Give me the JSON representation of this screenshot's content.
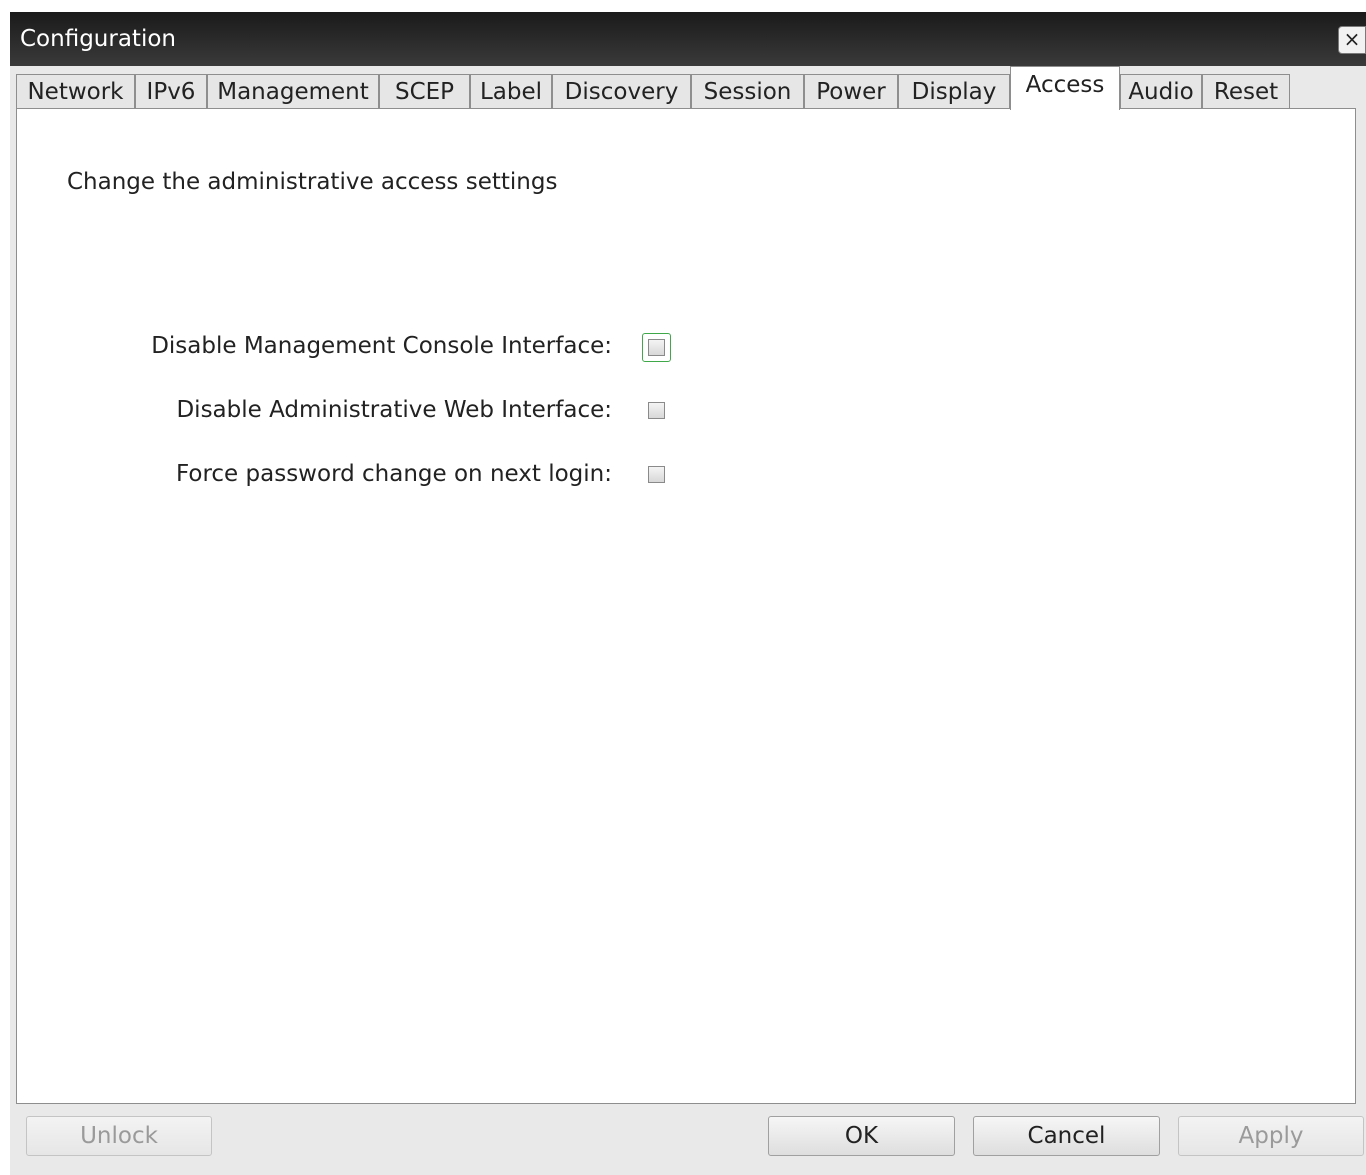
{
  "window": {
    "title": "Configuration",
    "close_label": "×"
  },
  "tabs": [
    {
      "label": "Network"
    },
    {
      "label": "IPv6"
    },
    {
      "label": "Management"
    },
    {
      "label": "SCEP"
    },
    {
      "label": "Label"
    },
    {
      "label": "Discovery"
    },
    {
      "label": "Session"
    },
    {
      "label": "Power"
    },
    {
      "label": "Display"
    },
    {
      "label": "Access",
      "selected": true
    },
    {
      "label": "Audio"
    },
    {
      "label": "Reset"
    }
  ],
  "access": {
    "heading": "Change the administrative access settings",
    "options": [
      {
        "label": "Disable Management Console Interface:",
        "checked": false,
        "focused": true
      },
      {
        "label": "Disable Administrative Web Interface:",
        "checked": false
      },
      {
        "label": "Force password change on next login:",
        "checked": false
      }
    ]
  },
  "buttons": {
    "unlock": "Unlock",
    "ok": "OK",
    "cancel": "Cancel",
    "apply": "Apply"
  }
}
